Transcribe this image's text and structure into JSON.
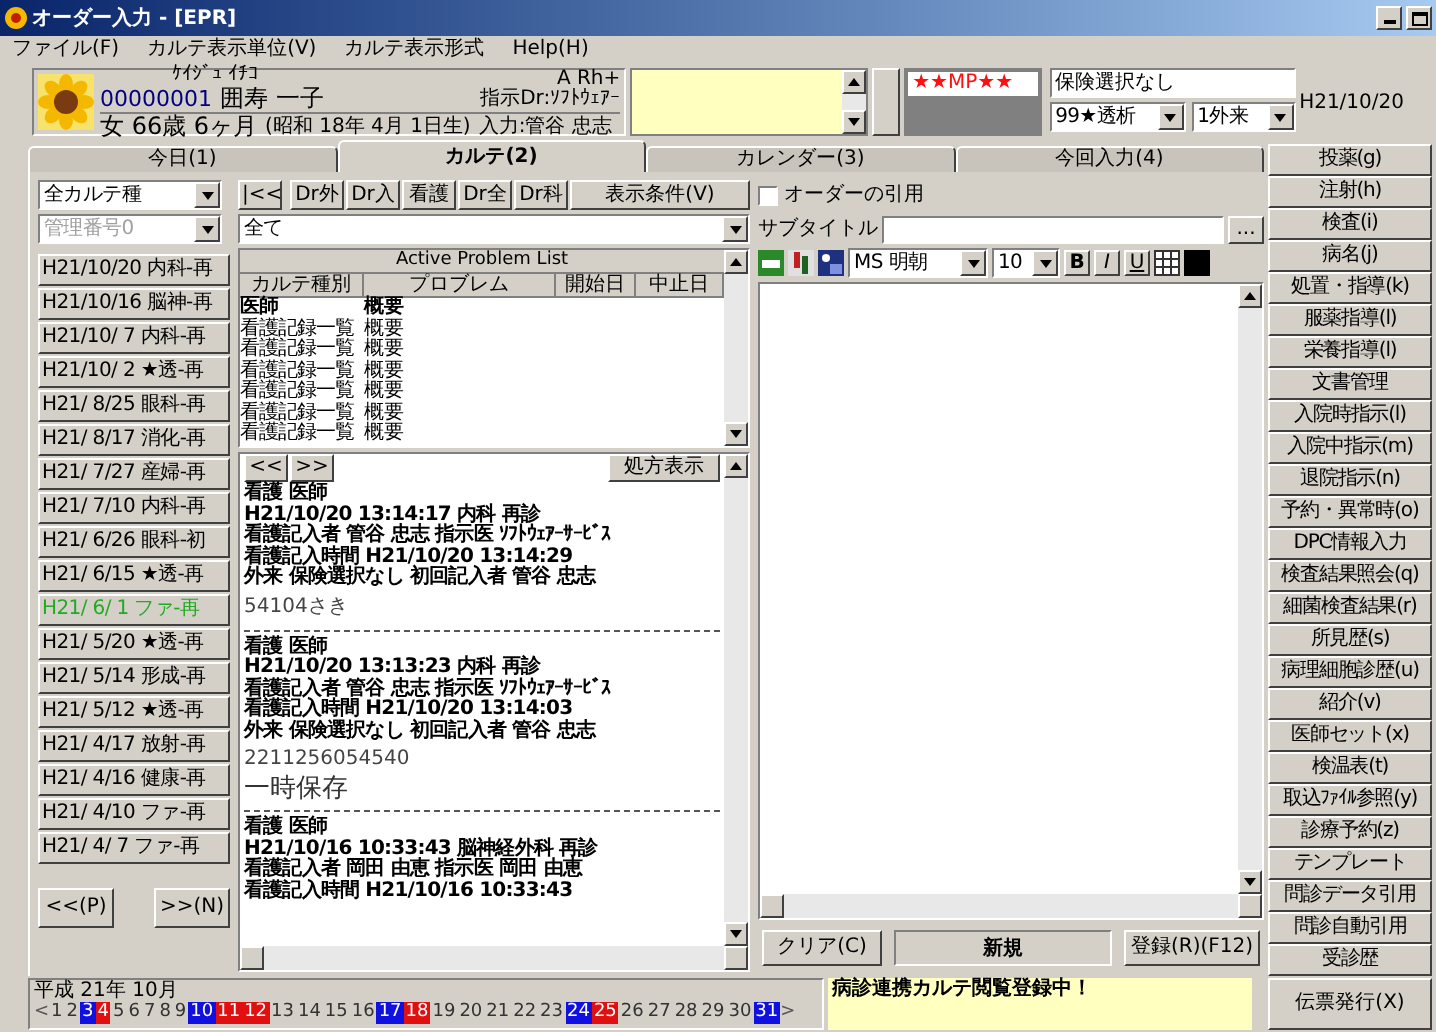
{
  "window": {
    "title": "オーダー入力 - [EPR]"
  },
  "menu": [
    "ファイル(F)",
    "カルテ表示単位(V)",
    "カルテ表示形式",
    "Help(H)"
  ],
  "patient": {
    "kana": "ｹｲｼﾞｭ ｲﾁｺ",
    "id": "00000001",
    "name": "囲寿 一子",
    "sex_age": "女 66歳 6ヶ月",
    "birth": "(昭和 18年 4月 1日生)",
    "entered_by": "入力:管谷 忠志",
    "blood": "A Rh+",
    "doctor": "指示Dr:ｿﾌﾄｳｪｱｰ",
    "alert": "★★MP★★",
    "insurance": "保険選択なし",
    "dept": "99★透析",
    "visit": "1外来",
    "date": "H21/10/20"
  },
  "tabs": [
    {
      "label": "今日(1)",
      "selected": false
    },
    {
      "label": "カルテ(2)",
      "selected": true
    },
    {
      "label": "カレンダー(3)",
      "selected": false
    },
    {
      "label": "今回入力(4)",
      "selected": false
    }
  ],
  "filters": {
    "karte_type": "全カルテ種",
    "management_no": "管理番号0",
    "first_button": "|<<",
    "buttons": [
      "Dr外",
      "Dr入",
      "看護",
      "Dr全",
      "Dr科"
    ],
    "conditions": "表示条件(V)",
    "scope": "全て"
  },
  "visits": [
    {
      "label": "H21/10/20 内科-再",
      "selected": false
    },
    {
      "label": "H21/10/16 脳神-再",
      "selected": false
    },
    {
      "label": "H21/10/ 7 内科-再",
      "selected": false
    },
    {
      "label": "H21/10/ 2 ★透-再",
      "selected": false
    },
    {
      "label": "H21/ 8/25 眼科-再",
      "selected": false
    },
    {
      "label": "H21/ 8/17 消化-再",
      "selected": false
    },
    {
      "label": "H21/ 7/27 産婦-再",
      "selected": false
    },
    {
      "label": "H21/ 7/10 内科-再",
      "selected": false
    },
    {
      "label": "H21/ 6/26 眼科-初",
      "selected": false
    },
    {
      "label": "H21/ 6/15 ★透-再",
      "selected": false
    },
    {
      "label": "H21/ 6/ 1 ファ-再",
      "selected": true
    },
    {
      "label": "H21/ 5/20 ★透-再",
      "selected": false
    },
    {
      "label": "H21/ 5/14 形成-再",
      "selected": false
    },
    {
      "label": "H21/ 5/12 ★透-再",
      "selected": false
    },
    {
      "label": "H21/ 4/17 放射-再",
      "selected": false
    },
    {
      "label": "H21/ 4/16 健康-再",
      "selected": false
    },
    {
      "label": "H21/ 4/10 ファ-再",
      "selected": false
    },
    {
      "label": "H21/ 4/ 7 ファ-再",
      "selected": false
    }
  ],
  "visit_nav": {
    "prev": "<<(P)",
    "next": ">>(N)"
  },
  "problem_list": {
    "title": "Active Problem List",
    "columns": [
      "カルテ種別",
      "プロブレム",
      "開始日",
      "中止日"
    ],
    "rows": [
      {
        "type": "医師",
        "problem": "概要",
        "bold": true
      },
      {
        "type": "看護記録一覧",
        "problem": "概要",
        "bold": false
      },
      {
        "type": "看護記録一覧",
        "problem": "概要",
        "bold": false
      },
      {
        "type": "看護記録一覧",
        "problem": "概要",
        "bold": false
      },
      {
        "type": "看護記録一覧",
        "problem": "概要",
        "bold": false
      },
      {
        "type": "看護記録一覧",
        "problem": "概要",
        "bold": false
      },
      {
        "type": "看護記録一覧",
        "problem": "概要",
        "bold": false
      }
    ]
  },
  "notes": {
    "prev": "<<",
    "next": ">>",
    "prescription": "処方表示",
    "entries": [
      {
        "kind": "record",
        "lines": [
          "看護 医師",
          "H21/10/20 13:14:17 内科 再診",
          "看護記入者 管谷 忠志 指示医 ｿﾌﾄｳｪｱｰｻｰﾋﾞｽ",
          "看護記入時間 H21/10/20 13:14:29",
          "外来 保険選択なし 初回記入者 管谷 忠志"
        ]
      },
      {
        "kind": "memo",
        "text": "54104さき"
      },
      {
        "kind": "separator"
      },
      {
        "kind": "record",
        "lines": [
          "看護 医師",
          "H21/10/20 13:13:23 内科 再診",
          "看護記入者 管谷 忠志 指示医 ｿﾌﾄｳｪｱｰｻｰﾋﾞｽ",
          "看護記入時間 H21/10/20 13:14:03",
          "外来 保険選択なし 初回記入者 管谷 忠志"
        ]
      },
      {
        "kind": "memo",
        "text": "2211256054540"
      },
      {
        "kind": "large",
        "text": "一時保存"
      },
      {
        "kind": "separator"
      },
      {
        "kind": "record",
        "lines": [
          "看護 医師",
          "H21/10/16 10:33:43 脳神経外科 再診",
          "看護記入者 岡田 由恵 指示医 岡田 由恵",
          "看護記入時間 H21/10/16 10:33:43"
        ]
      }
    ]
  },
  "editor": {
    "quote_order": {
      "label": "オーダーの引用",
      "checked": false
    },
    "subtitle_label": "サブタイトル",
    "browse": "...",
    "font": "MS 明朝",
    "size": "10",
    "bold": "B",
    "italic": "I",
    "underline": "U",
    "color": "#000000",
    "clear": "クリア(C)",
    "mode": "新規",
    "register": "登録(R)(F12)"
  },
  "order_buttons": [
    "投薬(g)",
    "注射(h)",
    "検査(i)",
    "病名(j)",
    "処置・指導(k)",
    "服薬指導(l)",
    "栄養指導(l)",
    "文書管理",
    "入院時指示(l)",
    "入院中指示(m)",
    "退院指示(n)",
    "予約・異常時(o)",
    "DPC情報入力",
    "検査結果照会(q)",
    "細菌検査結果(r)",
    "所見歴(s)",
    "病理細胞診歴(u)",
    "紹介(v)",
    "医師セット(x)",
    "検温表(t)",
    "取込ﾌｧｲﾙ参照(y)",
    "診療予約(z)",
    "テンプレート",
    "問診データ引用",
    "問診自動引用",
    "受診歴"
  ],
  "calendar": {
    "month": "平成 21年 10月",
    "prev": "<",
    "next": ">",
    "days": [
      {
        "day": "1",
        "kind": "weekday"
      },
      {
        "day": "2",
        "kind": "weekday"
      },
      {
        "day": "3",
        "kind": "saturday"
      },
      {
        "day": "4",
        "kind": "holiday"
      },
      {
        "day": "5",
        "kind": "weekday"
      },
      {
        "day": "6",
        "kind": "weekday"
      },
      {
        "day": "7",
        "kind": "weekday"
      },
      {
        "day": "8",
        "kind": "weekday"
      },
      {
        "day": "9",
        "kind": "weekday"
      },
      {
        "day": "10",
        "kind": "saturday"
      },
      {
        "day": "11",
        "kind": "holiday"
      },
      {
        "day": "12",
        "kind": "holiday"
      },
      {
        "day": "13",
        "kind": "weekday"
      },
      {
        "day": "14",
        "kind": "weekday"
      },
      {
        "day": "15",
        "kind": "weekday"
      },
      {
        "day": "16",
        "kind": "weekday"
      },
      {
        "day": "17",
        "kind": "saturday"
      },
      {
        "day": "18",
        "kind": "holiday"
      },
      {
        "day": "19",
        "kind": "weekday"
      },
      {
        "day": "20",
        "kind": "weekday"
      },
      {
        "day": "21",
        "kind": "weekday"
      },
      {
        "day": "22",
        "kind": "weekday"
      },
      {
        "day": "23",
        "kind": "weekday"
      },
      {
        "day": "24",
        "kind": "saturday"
      },
      {
        "day": "25",
        "kind": "holiday"
      },
      {
        "day": "26",
        "kind": "weekday"
      },
      {
        "day": "27",
        "kind": "weekday"
      },
      {
        "day": "28",
        "kind": "weekday"
      },
      {
        "day": "29",
        "kind": "weekday"
      },
      {
        "day": "30",
        "kind": "weekday"
      },
      {
        "day": "31",
        "kind": "saturday"
      }
    ]
  },
  "status_message": "病診連携カルテ閲覧登録中！",
  "print_button": "伝票発行(X)"
}
